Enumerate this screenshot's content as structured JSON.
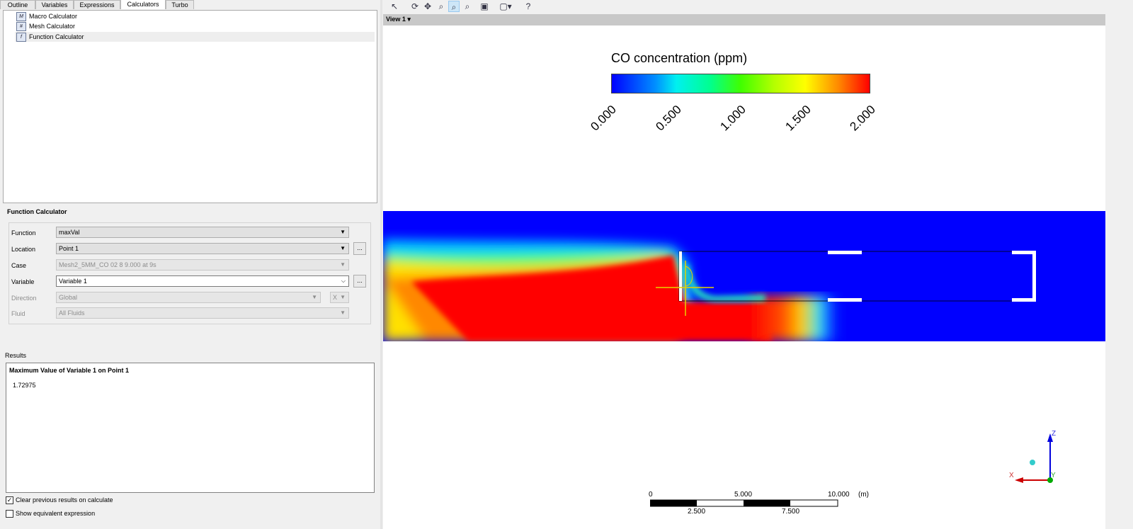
{
  "tabs": [
    {
      "label": "Outline"
    },
    {
      "label": "Variables"
    },
    {
      "label": "Expressions"
    },
    {
      "label": "Calculators"
    },
    {
      "label": "Turbo"
    }
  ],
  "tree": {
    "items": [
      {
        "label": "Macro Calculator",
        "icon": "macro-calculator-icon"
      },
      {
        "label": "Mesh Calculator",
        "icon": "mesh-calculator-icon"
      },
      {
        "label": "Function Calculator",
        "icon": "function-calculator-icon",
        "selected": true
      }
    ]
  },
  "function_calculator": {
    "title": "Function Calculator",
    "fields": [
      {
        "label": "Function",
        "value": "maxVal"
      },
      {
        "label": "Location",
        "value": "Point 1"
      },
      {
        "label": "Case",
        "value": "Mesh2_5MM_CO 02 8 9.000 at 9s"
      },
      {
        "label": "Variable",
        "value": "Variable 1"
      },
      {
        "label": "Direction",
        "value": "Global",
        "axis": "X"
      },
      {
        "label": "Fluid",
        "value": "All Fluids"
      }
    ],
    "dots_label": "..."
  },
  "results": {
    "label": "Results",
    "heading": "Maximum Value of Variable 1 on Point 1",
    "value": "1.72975"
  },
  "options": {
    "clear_previous": {
      "label": "Clear previous results on calculate",
      "checked": true
    },
    "show_equivalent": {
      "label": "Show equivalent expression",
      "checked": false
    }
  },
  "view": {
    "title": "View 1",
    "legend": {
      "title": "CO concentration (ppm)",
      "ticks": [
        "0.000",
        "0.500",
        "1.000",
        "1.500",
        "2.000"
      ]
    },
    "scale": {
      "top_labels": [
        "0",
        "5.000",
        "10.000"
      ],
      "unit": "(m)",
      "bottom_labels": [
        "2.500",
        "7.500"
      ]
    },
    "axes": {
      "z": "Z",
      "x": "X",
      "y": "Y"
    }
  }
}
